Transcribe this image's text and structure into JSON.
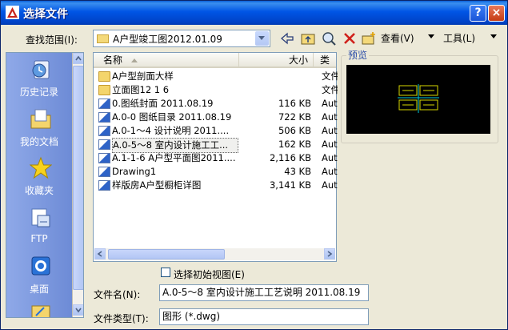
{
  "window": {
    "title": "选择文件",
    "help": "?",
    "close": "×"
  },
  "lookin": {
    "label": "查找范围(I):",
    "value": "A户型竣工图2012.01.09"
  },
  "toolbar": {
    "view_label": "查看(V)",
    "tools_label": "工具(L)"
  },
  "places": [
    {
      "label": "历史记录",
      "icon": "history-icon"
    },
    {
      "label": "我的文档",
      "icon": "my-documents-icon"
    },
    {
      "label": "收藏夹",
      "icon": "favorites-icon"
    },
    {
      "label": "FTP",
      "icon": "ftp-icon"
    },
    {
      "label": "桌面",
      "icon": "desktop-icon"
    }
  ],
  "columns": {
    "name": "名称",
    "size": "大小",
    "type": "类"
  },
  "files": [
    {
      "name": "A户型剖面大样",
      "size": "",
      "type": "文件",
      "kind": "folder"
    },
    {
      "name": "立面图12 1 6",
      "size": "",
      "type": "文件",
      "kind": "folder"
    },
    {
      "name": "0.图纸封面 2011.08.19",
      "size": "116 KB",
      "type": "Aut",
      "kind": "dwg"
    },
    {
      "name": "A.0-0 图纸目录 2011.08.19",
      "size": "722 KB",
      "type": "Aut",
      "kind": "dwg"
    },
    {
      "name": "A.0-1～4 设计说明 2011....",
      "size": "506 KB",
      "type": "Aut",
      "kind": "dwg"
    },
    {
      "name": "A.0-5～8 室内设计施工工...",
      "size": "162 KB",
      "type": "Aut",
      "kind": "dwg"
    },
    {
      "name": "A.1-1-6 A户型平面图2011....",
      "size": "2,116 KB",
      "type": "Aut",
      "kind": "dwg"
    },
    {
      "name": "Drawing1",
      "size": "43 KB",
      "type": "Aut",
      "kind": "dwg"
    },
    {
      "name": "样版房A户型橱柜详图",
      "size": "3,141 KB",
      "type": "Aut",
      "kind": "dwg"
    }
  ],
  "preview": {
    "label": "预览"
  },
  "initial_view": {
    "label": "选择初始视图(E)",
    "checked": false
  },
  "filename": {
    "label": "文件名(N):",
    "value": "A.0-5～8 室内设计施工工艺说明 2011.08.19"
  },
  "filetype": {
    "label": "文件类型(T):",
    "value": "图形 (*.dwg)"
  }
}
